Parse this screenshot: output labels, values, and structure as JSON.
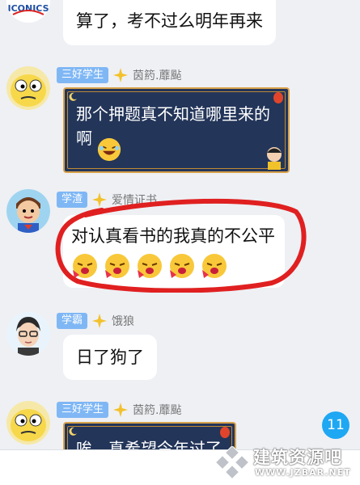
{
  "messages": [
    {
      "text": "算了，考不过么明年再来"
    },
    {
      "tag": "三好学生",
      "name": "茵箹.蘼颭",
      "text": "那个押题真不知道哪里来的啊"
    },
    {
      "tag": "学渣",
      "name": "爱情证书",
      "text": "对认真看书的我真的不公平"
    },
    {
      "tag": "学霸",
      "name": "饿狼",
      "text": "日了狗了"
    },
    {
      "tag": "三好学生",
      "name": "茵箹.蘼颭",
      "text": "唉，真希望今年过了"
    }
  ],
  "top_avatar_text": "ICONICS",
  "unread_badge": "11",
  "watermark": {
    "title": "建筑资源吧",
    "url": "WWW.JZBAR.NET"
  },
  "colors": {
    "tag_bg": "#7fb7f5",
    "dark_bubble": "#233559",
    "badge": "#1ea7f3",
    "circle": "#e02020"
  }
}
